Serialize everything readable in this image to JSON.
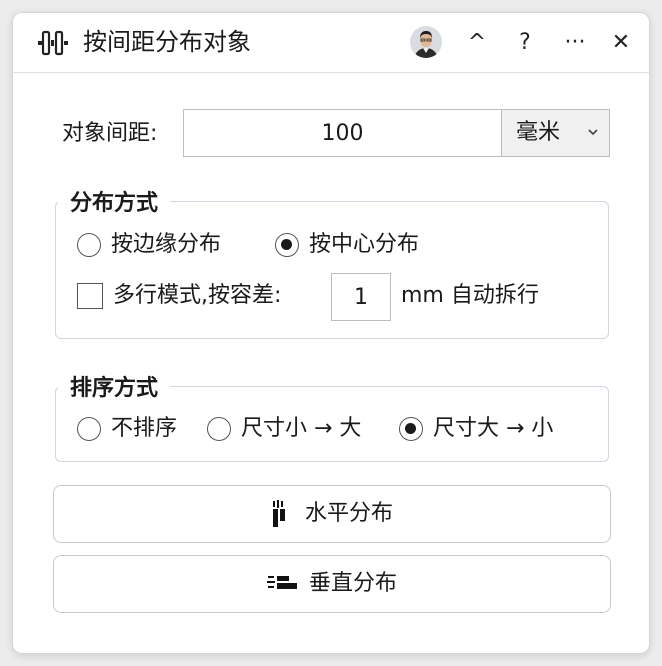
{
  "window": {
    "title": "按间距分布对象",
    "collapse_label": "^",
    "help_label": "?",
    "more_label": "···",
    "close_label": "✕",
    "icons": {
      "app": "distribute-icon",
      "avatar": "user-avatar"
    }
  },
  "spacing": {
    "label": "对象间距:",
    "value": "100",
    "unit": "毫米"
  },
  "distribution": {
    "legend": "分布方式",
    "options": [
      {
        "label": "按边缘分布",
        "checked": false
      },
      {
        "label": "按中心分布",
        "checked": true
      }
    ],
    "multiline_label": "多行模式,按容差:",
    "multiline_checked": false,
    "tolerance_value": "1",
    "tolerance_suffix": "mm 自动拆行"
  },
  "sort": {
    "legend": "排序方式",
    "options": [
      {
        "label": "不排序",
        "checked": false
      },
      {
        "label": "尺寸小 → 大",
        "checked": false
      },
      {
        "label": "尺寸大 → 小",
        "checked": true
      }
    ]
  },
  "actions": {
    "horizontal_label": "水平分布",
    "vertical_label": "垂直分布"
  }
}
